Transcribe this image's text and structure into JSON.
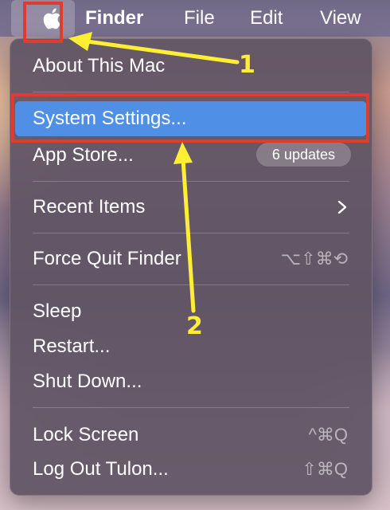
{
  "menubar": {
    "apple_menu_label": "",
    "finder": "Finder",
    "file": "File",
    "edit": "Edit",
    "view": "View"
  },
  "menu": {
    "about": "About This Mac",
    "system_settings": "System Settings...",
    "app_store": "App Store...",
    "app_store_badge": "6 updates",
    "recent_items": "Recent Items",
    "force_quit": "Force Quit Finder",
    "force_quit_shortcut": "⌥⇧⌘⟲",
    "sleep": "Sleep",
    "restart": "Restart...",
    "shut_down": "Shut Down...",
    "lock_screen": "Lock Screen",
    "lock_screen_shortcut": "^⌘Q",
    "log_out": "Log Out Tulon...",
    "log_out_shortcut": "⇧⌘Q"
  },
  "annotations": {
    "step1": "1",
    "step2": "2",
    "highlight_color": "#e13a2f",
    "arrow_color": "#ffee33"
  },
  "colors": {
    "selection": "#4f8fe6",
    "menu_bg": "#605464"
  }
}
